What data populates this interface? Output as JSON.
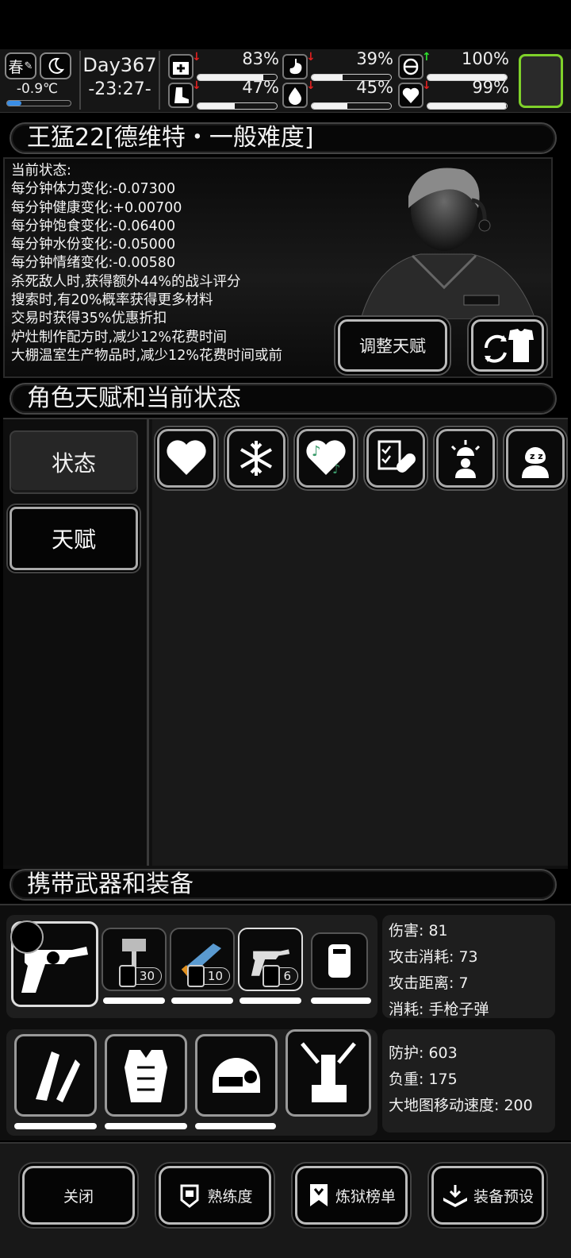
{
  "topbar": {
    "season": "春",
    "weather_icon": "quill-icon",
    "night_icon": "moon-icon",
    "temperature": "-0.9℃",
    "temperature_level": 0.22,
    "day": "Day367",
    "time": "-23:27-",
    "stats": [
      {
        "icon": "medkit-icon",
        "trend": "down",
        "percent": "83%",
        "level": 0.83
      },
      {
        "icon": "stomach-icon",
        "trend": "down",
        "percent": "39%",
        "level": 0.39
      },
      {
        "icon": "pill-icon",
        "trend": "up",
        "percent": "100%",
        "level": 1.0
      },
      {
        "icon": "boot-icon",
        "trend": "down",
        "percent": "47%",
        "level": 0.47
      },
      {
        "icon": "water-drop-icon",
        "trend": "down",
        "percent": "45%",
        "level": 0.45
      },
      {
        "icon": "heart-icon",
        "trend": "down",
        "percent": "99%",
        "level": 0.99
      }
    ],
    "accent_green": "#7fd12a",
    "arrow_up": "↑",
    "arrow_down": "↓"
  },
  "character": {
    "title": "王猛22[德维特・一般难度]",
    "effects": [
      "当前状态:",
      "每分钟体力变化:-0.07300",
      "每分钟健康变化:+0.00700",
      "每分钟饱食变化:-0.06400",
      "每分钟水份变化:-0.05000",
      "每分钟情绪变化:-0.00580",
      "杀死敌人时,获得额外44%的战斗评分",
      "搜索时,有20%概率获得更多材料",
      "交易时获得35%优惠折扣",
      "炉灶制作配方时,减少12%花费时间",
      "大棚温室生产物品时,减少12%花费时间或前"
    ],
    "adjust_talent_label": "调整天赋",
    "change_outfit_icon": "outfit-swap-icon"
  },
  "talent_section": {
    "title": "角色天赋和当前状态",
    "tabs": [
      {
        "label": "状态",
        "active": true
      },
      {
        "label": "天赋",
        "active": false
      }
    ],
    "status_icons": [
      "heart-icon",
      "snowflake-icon",
      "music-heart-icon",
      "medical-checklist-icon",
      "alarm-person-icon",
      "sleep-icon"
    ]
  },
  "equipment": {
    "title": "携带武器和装备",
    "weapons": [
      {
        "icon": "revolver-icon",
        "selected": true
      },
      {
        "icon": "sledgehammer-icon",
        "ammo": "30",
        "durability": 1.0
      },
      {
        "icon": "blaster-gun-icon",
        "ammo": "10",
        "durability": 1.0
      },
      {
        "icon": "revolver-icon",
        "ammo": "6",
        "durability": 1.0
      },
      {
        "icon": "canister-icon",
        "durability": 1.0
      }
    ],
    "weapon_stats": [
      "伤害: 81",
      "攻击消耗: 73",
      "攻击距离: 7",
      "消耗: 手枪子弹"
    ],
    "gear": [
      {
        "icon": "arm-guard-icon",
        "durability": 1.0
      },
      {
        "icon": "body-armor-icon",
        "durability": 1.0
      },
      {
        "icon": "combat-helmet-icon",
        "durability": 0.98
      },
      {
        "icon": "backpack-frame-icon"
      }
    ],
    "gear_stats": [
      "防护: 603",
      "负重: 175",
      "大地图移动速度: 200"
    ]
  },
  "bottom": {
    "buttons": [
      {
        "label": "关闭",
        "icon": ""
      },
      {
        "label": "熟练度",
        "icon": "proficiency-icon"
      },
      {
        "label": "炼狱榜单",
        "icon": "banner-icon"
      },
      {
        "label": "装备预设",
        "icon": "gear-preset-icon"
      }
    ]
  }
}
